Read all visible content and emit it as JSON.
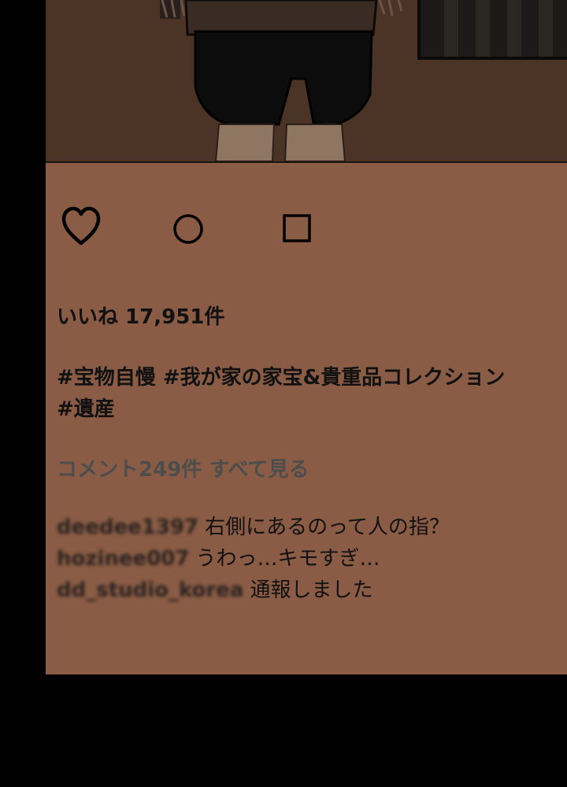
{
  "post": {
    "likes_text": "いいね 17,951件",
    "hashtags_line1": "#宝物自慢 #我が家の家宝&貴重品コレクション",
    "hashtags_line2": "#遺産",
    "view_all_comments": "コメント249件 すべて見る"
  },
  "comments": [
    {
      "user": "deedee1397",
      "text": "右側にあるのって人の指？"
    },
    {
      "user": "hozinee007",
      "text": "うわっ…キモすぎ…"
    },
    {
      "user": "dd_studio_korea",
      "text": "通報しました"
    }
  ],
  "icons": {
    "like": "heart-outline-icon",
    "comment": "circle-outline-icon",
    "share": "square-outline-icon"
  },
  "colors": {
    "panel_background": "#8a5c45",
    "photo_background": "#4b3326",
    "outer_background": "#000000"
  }
}
